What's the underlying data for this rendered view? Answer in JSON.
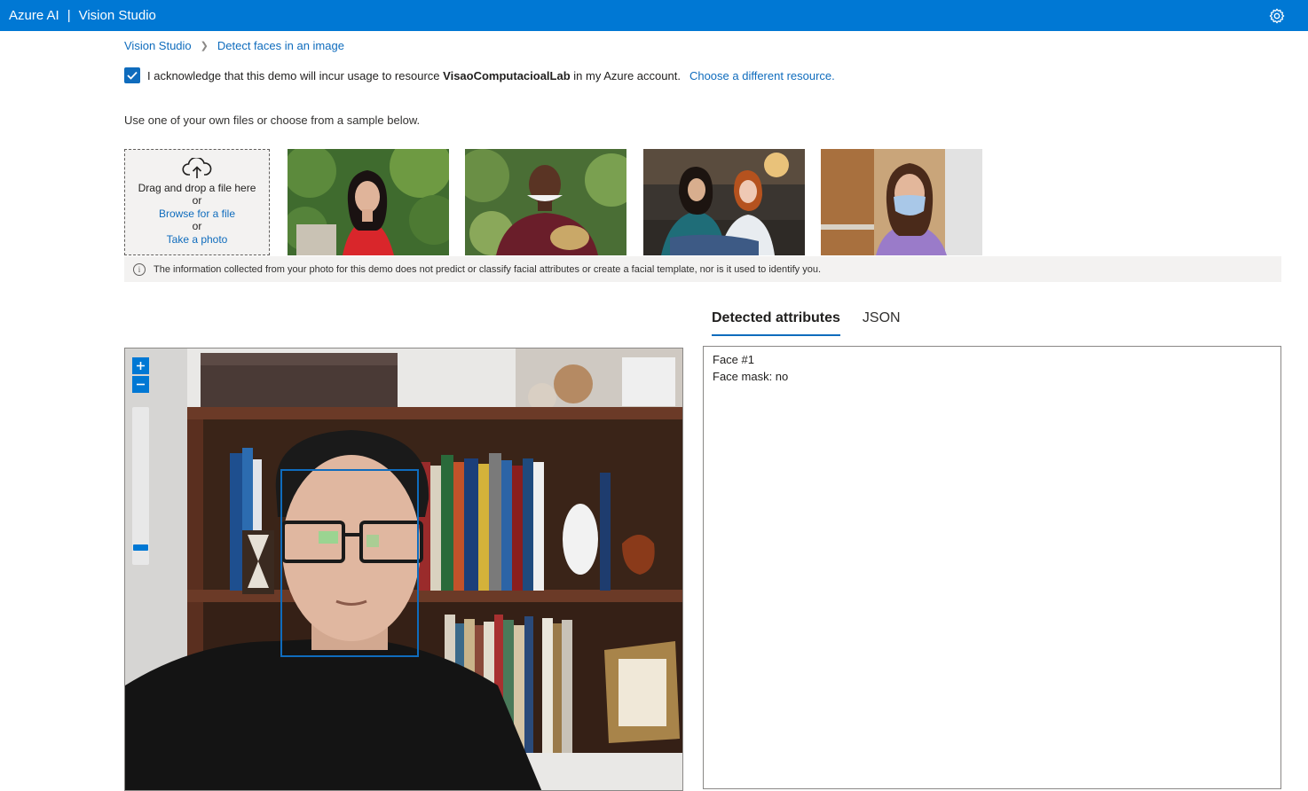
{
  "header": {
    "brand": "Azure AI",
    "separator": "|",
    "product": "Vision Studio",
    "settings_icon": "gear-icon"
  },
  "breadcrumb": {
    "root": "Vision Studio",
    "current": "Detect faces in an image"
  },
  "acknowledgement": {
    "checked": true,
    "text_before": "I acknowledge that this demo will incur usage to resource",
    "resource_name": "VisaoComputacioalLab",
    "text_after": "in my Azure account.",
    "change_link": "Choose a different resource."
  },
  "intro_text": "Use one of your own files or choose from a sample below.",
  "upload": {
    "icon": "cloud-upload-icon",
    "drag_text": "Drag and drop a file here",
    "or1": "or",
    "browse_link": "Browse for a file",
    "or2": "or",
    "photo_link": "Take a photo"
  },
  "samples": [
    {
      "description": "sample-woman-red-dress"
    },
    {
      "description": "sample-man-holding-hat"
    },
    {
      "description": "sample-two-women-office"
    },
    {
      "description": "sample-woman-face-mask"
    }
  ],
  "notice": {
    "icon": "info-icon",
    "text": "The information collected from your photo for this demo does not predict or classify facial attributes or create a facial template, nor is it used to identify you."
  },
  "tabs": [
    {
      "label": "Detected attributes",
      "active": true
    },
    {
      "label": "JSON",
      "active": false
    }
  ],
  "preview": {
    "zoom_in_icon": "plus-icon",
    "zoom_out_icon": "minus-icon"
  },
  "results": {
    "face_label": "Face #1",
    "mask_line": "Face mask: no"
  },
  "colors": {
    "accent": "#0078d4",
    "link": "#0f6cbd"
  }
}
